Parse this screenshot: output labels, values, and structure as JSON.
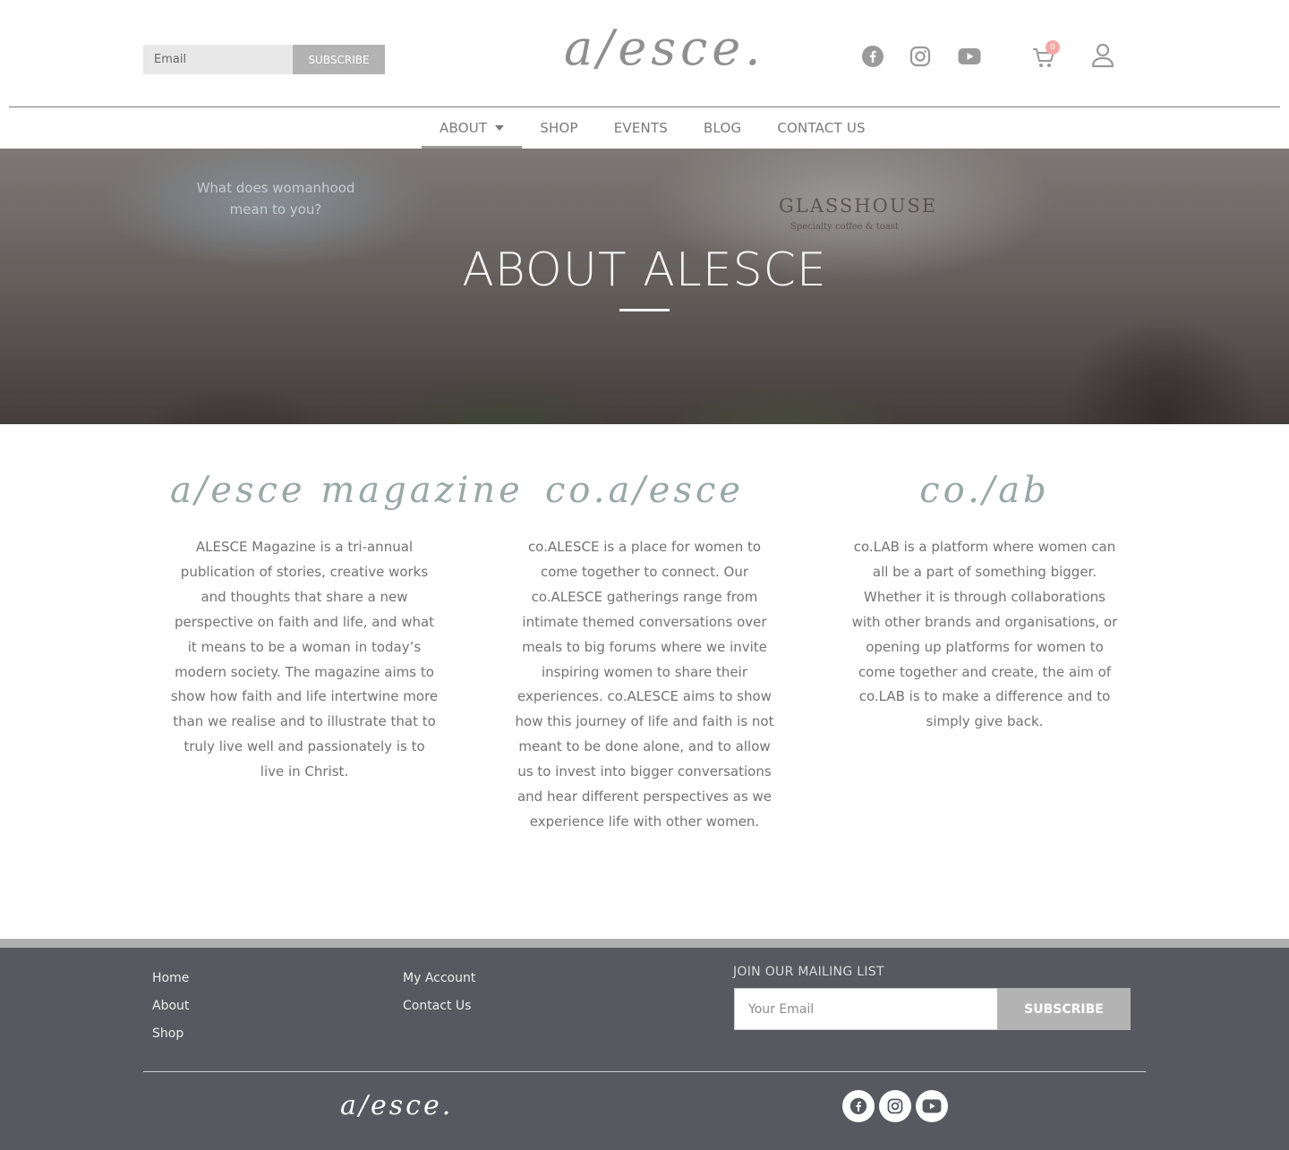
{
  "header": {
    "subscribe": {
      "email_placeholder": "Email",
      "button_label": "SUBSCRIBE"
    },
    "logo_text": "a/esce.",
    "social_icons": [
      "facebook-icon",
      "instagram-icon",
      "youtube-icon"
    ],
    "cart_count": "0",
    "nav": [
      {
        "label": "ABOUT",
        "has_dropdown": true,
        "active": true
      },
      {
        "label": "SHOP"
      },
      {
        "label": "EVENTS"
      },
      {
        "label": "BLOG"
      },
      {
        "label": "CONTACT US"
      }
    ]
  },
  "hero": {
    "title": "ABOUT ALESCE",
    "sign_text": "What does womanhood mean to you?",
    "glasshouse": "GLASSHOUSE",
    "glasshouse_sub": "Specialty coffee & toast"
  },
  "columns": [
    {
      "title": "a/esce magazine",
      "text": "ALESCE Magazine is a tri-annual publication of stories, creative works and thoughts that share a new perspective on faith and life, and what it means to be a woman in today’s modern society. The magazine aims to show how faith and life intertwine more than we realise and to illustrate that to truly live well and passionately is to live in Christ."
    },
    {
      "title": "co.a/esce",
      "text": "co.ALESCE is a place for women to come together to connect. Our co.ALESCE gatherings range from intimate themed conversations over meals to big forums where we invite inspiring women to share their experiences. co.ALESCE aims to show how this journey of life and faith is not meant to be done alone, and to allow us to invest into bigger conversations and hear different perspectives as we experience life with other women."
    },
    {
      "title": "co./ab",
      "text": "co.LAB is a platform where women can all be a part of something bigger. Whether it is through collaborations with other brands and organisations, or opening up platforms for women to come together and create, the aim of co.LAB is to make a difference and to simply give back."
    }
  ],
  "footer": {
    "links_col1": [
      "Home",
      "About",
      "Shop"
    ],
    "links_col2": [
      "My Account",
      "Contact Us"
    ],
    "mailing_title": "JOIN OUR MAILING LIST",
    "mailing_placeholder": "Your Email",
    "mailing_button": "SUBSCRIBE",
    "logo_text": "a/esce.",
    "social_icons": [
      "facebook-icon",
      "instagram-icon",
      "youtube-icon"
    ]
  },
  "colors": {
    "accent_script": "#98a8a5",
    "footer_bg": "#585960",
    "button_grey": "#b3b3b3",
    "cart_badge": "#f5a7a7"
  }
}
